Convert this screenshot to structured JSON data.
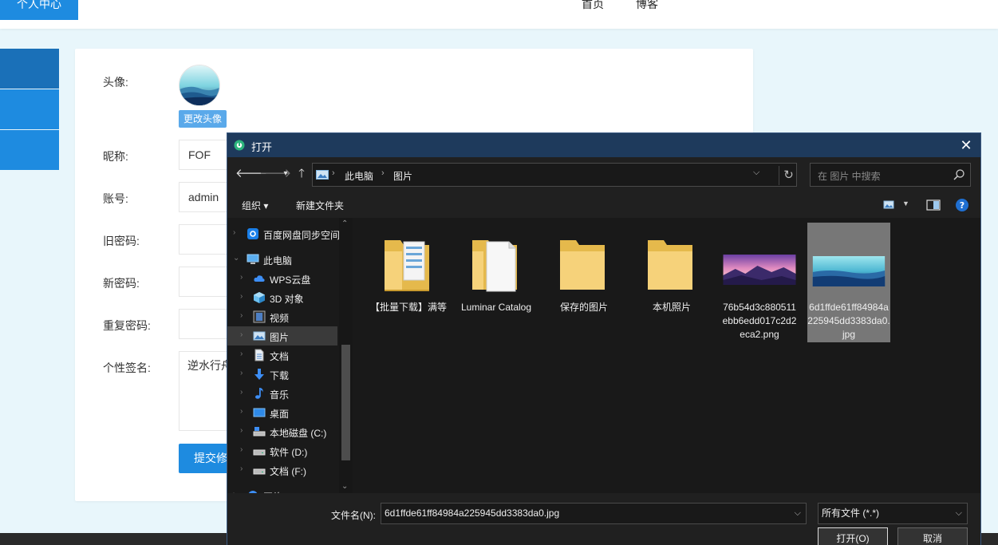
{
  "site": {
    "nav": {
      "home": "首页",
      "blog": "博客",
      "profile": "个人中心"
    },
    "form": {
      "avatar_label": "头像:",
      "change_avatar": "更改头像",
      "nickname_label": "昵称:",
      "nickname_value": "FOF",
      "account_label": "账号:",
      "account_value": "admin",
      "old_pwd_label": "旧密码:",
      "new_pwd_label": "新密码:",
      "repeat_pwd_label": "重复密码:",
      "signature_label": "个性签名:",
      "signature_value": "逆水行舟",
      "submit_label": "提交修"
    },
    "colors": {
      "accent": "#1e8be0",
      "background": "#e8f6fb"
    }
  },
  "dialog": {
    "title": "打开",
    "close_glyph": "✕",
    "address": {
      "root": "此电脑",
      "current": "图片"
    },
    "search_placeholder": "在 图片 中搜索",
    "toolbar": {
      "organize": "组织 ▾",
      "new_folder": "新建文件夹"
    },
    "tree": [
      {
        "label": "百度网盘同步空间",
        "icon": "baidu-netdisk-icon"
      },
      {
        "label": "此电脑",
        "icon": "computer-icon"
      },
      {
        "label": "WPS云盘",
        "icon": "cloud-icon"
      },
      {
        "label": "3D 对象",
        "icon": "cube-icon"
      },
      {
        "label": "视频",
        "icon": "video-icon"
      },
      {
        "label": "图片",
        "icon": "picture-icon",
        "selected": true
      },
      {
        "label": "文档",
        "icon": "document-icon"
      },
      {
        "label": "下载",
        "icon": "download-icon"
      },
      {
        "label": "音乐",
        "icon": "music-icon"
      },
      {
        "label": "桌面",
        "icon": "desktop-icon"
      },
      {
        "label": "本地磁盘 (C:)",
        "icon": "drive-c-icon"
      },
      {
        "label": "软件 (D:)",
        "icon": "drive-icon"
      },
      {
        "label": "文档 (F:)",
        "icon": "drive-icon"
      },
      {
        "label": "网络",
        "icon": "network-icon"
      }
    ],
    "files": [
      {
        "name": "【批量下载】满等",
        "type": "folder-doc"
      },
      {
        "name": "Luminar Catalog",
        "type": "folder-paper"
      },
      {
        "name": "保存的图片",
        "type": "folder"
      },
      {
        "name": "本机照片",
        "type": "folder"
      },
      {
        "name": "76b54d3c880511ebb6edd017c2d2eca2.png",
        "type": "image-sunset"
      },
      {
        "name": "6d1ffde61ff84984a225945dd3383da0.jpg",
        "type": "image-mountain",
        "selected": true
      }
    ],
    "filename_label": "文件名(N):",
    "filename_value": "6d1ffde61ff84984a225945dd3383da0.jpg",
    "filetype_value": "所有文件 (*.*)",
    "open_button": "打开(O)",
    "cancel_button": "取消"
  }
}
